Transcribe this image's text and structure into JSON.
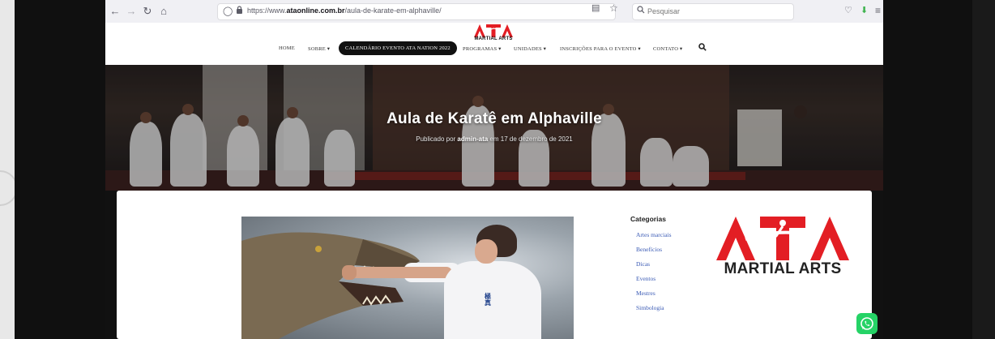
{
  "browser": {
    "url_prefix": "https://www.",
    "url_domain": "ataonline.com.br",
    "url_path": "/aula-de-karate-em-alphaville/",
    "search_placeholder": "Pesquisar"
  },
  "icons": {
    "back": "←",
    "forward": "→",
    "reload": "↻",
    "home": "⌂",
    "shield": "◯",
    "lock": "🔒",
    "reader": "▤",
    "bookmark": "☆",
    "search": "⚲",
    "pocket": "♡",
    "download": "⬇",
    "menu": "≡"
  },
  "site": {
    "logo_text": "MARTIAL ARTS",
    "menu": {
      "home": "HOME",
      "sobre": "SOBRE ▾",
      "calendario": "CALENDÁRIO EVENTO ATA NATION 2022",
      "programas": "PROGRAMAS ▾",
      "unidades": "UNIDADES ▾",
      "inscricoes": "INSCRIÇÕES PARA O EVENTO ▾",
      "contato": "CONTATO ▾"
    }
  },
  "post": {
    "title": "Aula de Karatê em Alphaville",
    "meta_prefix": "Publicado por ",
    "author": "admin-ata",
    "meta_suffix": " em 17 de dezembro de 2021",
    "featured_kanji": "極真"
  },
  "sidebar": {
    "heading": "Categorias",
    "categories": [
      "Artes marciais",
      "Benefícios",
      "Dicas",
      "Eventos",
      "Mestres",
      "Simbologia"
    ]
  },
  "colors": {
    "brand_red": "#e31e24",
    "link_blue": "#3b5bb5",
    "whatsapp_green": "#25d366"
  }
}
